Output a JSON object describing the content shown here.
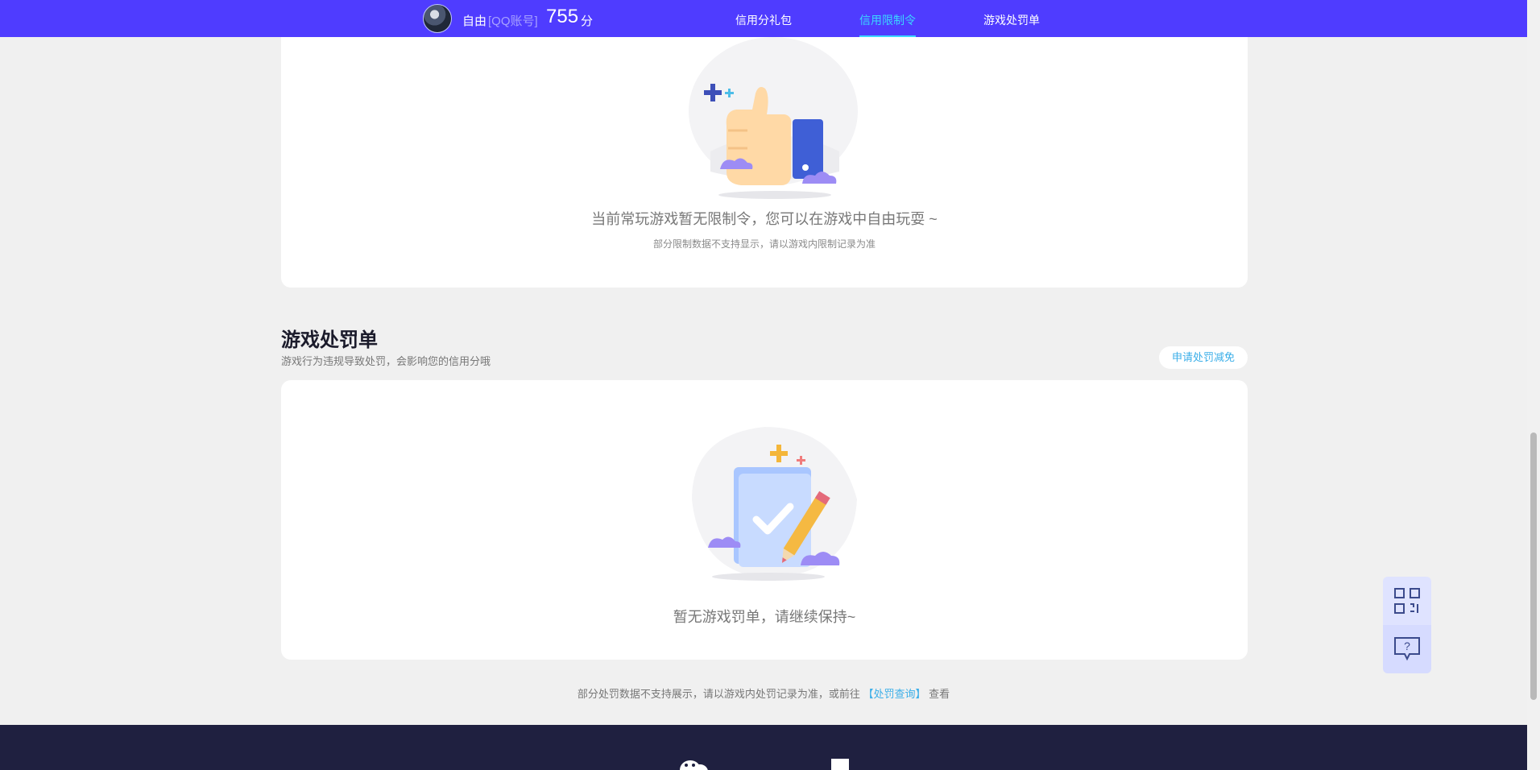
{
  "header": {
    "user_name": "自由",
    "account_type": "[QQ账号]",
    "score": "755",
    "score_unit": "分",
    "tabs": [
      {
        "label": "信用分礼包",
        "active": false
      },
      {
        "label": "信用限制令",
        "active": true
      },
      {
        "label": "游戏处罚单",
        "active": false
      }
    ]
  },
  "restriction": {
    "empty_text": "当前常玩游戏暂无限制令，您可以在游戏中自由玩耍 ~",
    "note": "部分限制数据不支持显示，请以游戏内限制记录为准"
  },
  "penalty": {
    "title": "游戏处罚单",
    "description": "游戏行为违规导致处罚，会影响您的信用分哦",
    "appeal_button": "申请处罚减免",
    "empty_text": "暂无游戏罚单，请继续保持~"
  },
  "footer": {
    "note_prefix": "部分处罚数据不支持展示，请以游戏内处罚记录为准，或前往",
    "link": "【处罚查询】",
    "note_suffix": "查看"
  },
  "floating_tools": [
    {
      "icon": "qr-code-icon"
    },
    {
      "icon": "help-chat-icon"
    }
  ],
  "colors": {
    "nav_bg": "#4f3cff",
    "accent_cyan": "#3ad7ff",
    "link_blue": "#3aaee8",
    "footer_bg": "#1f2040"
  }
}
